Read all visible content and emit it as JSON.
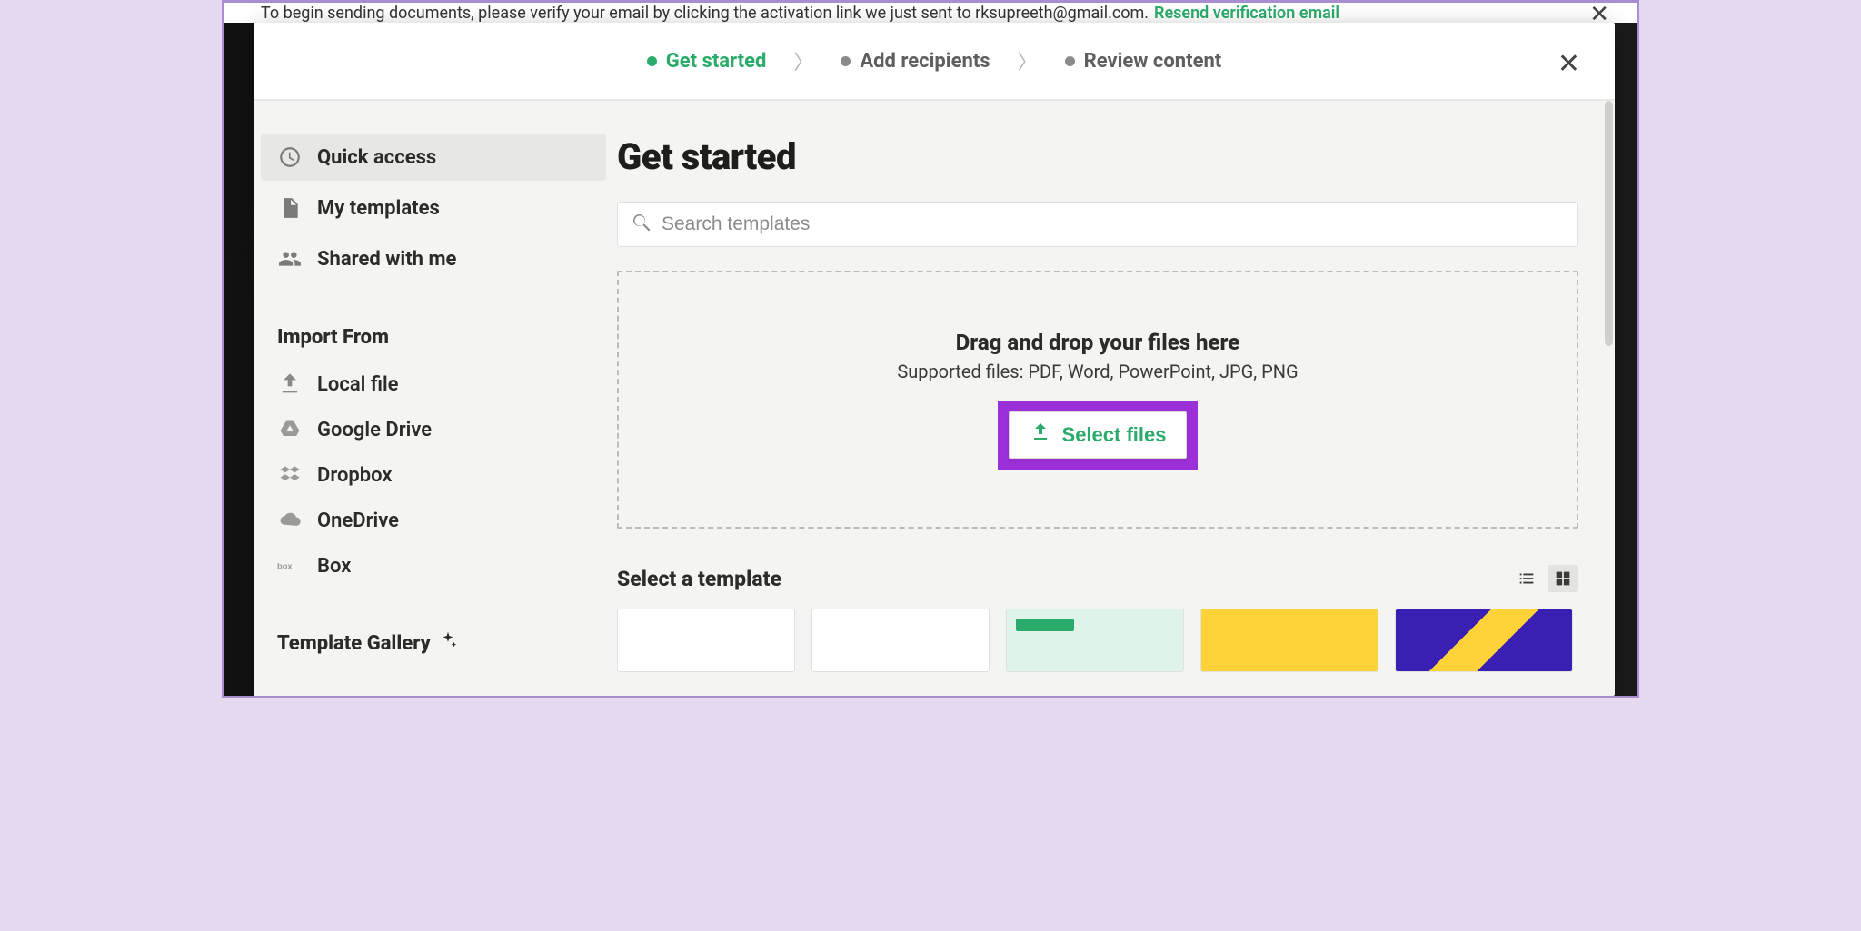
{
  "banner": {
    "text": "To begin sending documents, please verify your email by clicking the activation link we just sent to rksupreeth@gmail.com.",
    "link": "Resend verification email"
  },
  "steps": {
    "s1": "Get started",
    "s2": "Add recipients",
    "s3": "Review content"
  },
  "sidebar": {
    "quick_access": "Quick access",
    "my_templates": "My templates",
    "shared_with_me": "Shared with me",
    "import_from_title": "Import From",
    "imports": {
      "local": "Local file",
      "gdrive": "Google Drive",
      "dropbox": "Dropbox",
      "onedrive": "OneDrive",
      "box": "Box"
    },
    "template_gallery": "Template Gallery"
  },
  "main": {
    "title": "Get started",
    "search_placeholder": "Search templates",
    "drop_title": "Drag and drop your files here",
    "drop_sub": "Supported files: PDF, Word, PowerPoint, JPG, PNG",
    "select_files": "Select files",
    "select_template_title": "Select a template"
  }
}
